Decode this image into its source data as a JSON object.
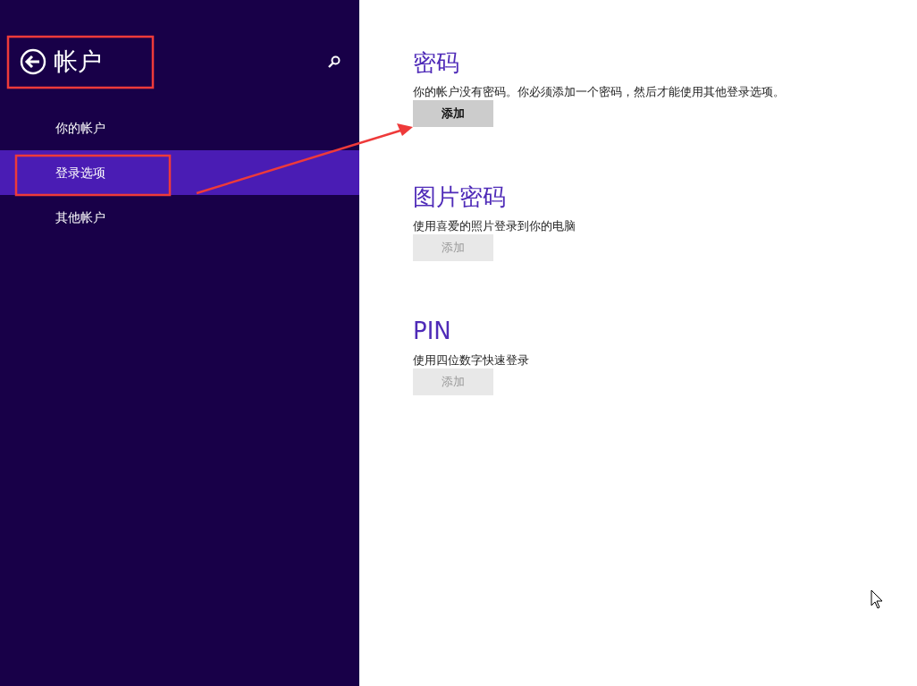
{
  "sidebar": {
    "title": "帐户",
    "items": [
      {
        "label": "你的帐户",
        "selected": false
      },
      {
        "label": "登录选项",
        "selected": true
      },
      {
        "label": "其他帐户",
        "selected": false
      }
    ]
  },
  "sections": [
    {
      "heading": "密码",
      "description": "你的帐户没有密码。你必须添加一个密码，然后才能使用其他登录选项。",
      "button": {
        "label": "添加",
        "disabled": false
      }
    },
    {
      "heading": "图片密码",
      "description": "使用喜爱的照片登录到你的电脑",
      "button": {
        "label": "添加",
        "disabled": true
      }
    },
    {
      "heading": "PIN",
      "description": "使用四位数字快速登录",
      "button": {
        "label": "添加",
        "disabled": true
      }
    }
  ]
}
